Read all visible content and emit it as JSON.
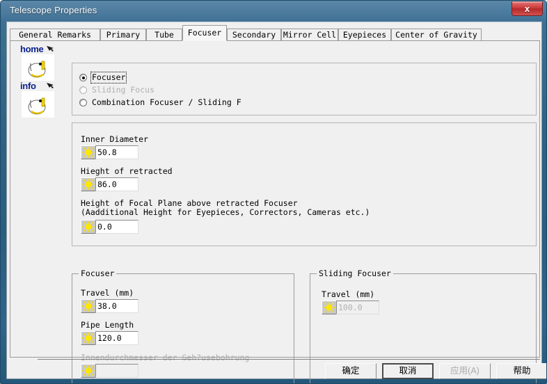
{
  "window": {
    "title": "Telescope Properties",
    "close_label": "x",
    "titlebar_color": "#2e6184",
    "client_bg": "#f0f0f0"
  },
  "tabs": [
    {
      "label": "General Remarks",
      "active": false
    },
    {
      "label": "Primary",
      "active": false
    },
    {
      "label": "Tube",
      "active": false
    },
    {
      "label": "Focuser",
      "active": true
    },
    {
      "label": "Secondary",
      "active": false
    },
    {
      "label": "Mirror Cell",
      "active": false
    },
    {
      "label": "Eyepieces",
      "active": false
    },
    {
      "label": "Center of Gravity",
      "active": false
    }
  ],
  "rail": {
    "items": [
      {
        "label": "home",
        "icon": "bird-icon",
        "arrow": "arrow-right-icon"
      },
      {
        "label": "info",
        "icon": "bird-icon",
        "arrow": "arrow-right-icon"
      }
    ]
  },
  "focuser_type": {
    "options": [
      {
        "label": "Focuser",
        "checked": true,
        "disabled": false,
        "focused": true
      },
      {
        "label": "Sliding Focus",
        "checked": false,
        "disabled": true,
        "focused": false
      },
      {
        "label": "Combination Focuser / Sliding F",
        "checked": false,
        "disabled": false,
        "focused": false
      }
    ]
  },
  "dimensions": {
    "inner_diameter": {
      "label": "Inner Diameter",
      "value": "50.8",
      "icon": "sun-icon",
      "disabled": false
    },
    "height_retracted": {
      "label": "Hieght of retracted",
      "value": "86.0",
      "icon": "sun-icon",
      "disabled": false
    },
    "focal_plane": {
      "label_line1": "Height of Focal Plane above retracted Focuser",
      "label_line2": "(Aadditional Height for Eyepieces, Correctors, Cameras etc.)",
      "value": "0.0",
      "icon": "sun-icon",
      "disabled": false
    }
  },
  "focuser_group": {
    "title": "Focuser",
    "travel": {
      "label": "Travel (mm)",
      "value": "38.0",
      "icon": "sun-icon",
      "disabled": false
    },
    "pipe_length": {
      "label": "Pipe Length",
      "value": "120.0",
      "icon": "sun-icon",
      "disabled": false
    },
    "bore_diameter": {
      "label": "Innendurchmesser der Geh?usebohrung",
      "value": "",
      "icon": "sun-icon",
      "disabled": true
    }
  },
  "sliding_focuser_group": {
    "title": "Sliding Focuser",
    "travel": {
      "label": "Travel (mm)",
      "value": "100.0",
      "icon": "sun-icon",
      "disabled": true
    }
  },
  "buttons": [
    {
      "label": "确定",
      "state": "normal"
    },
    {
      "label": "取消",
      "state": "default"
    },
    {
      "label": "应用(A)",
      "state": "disabled"
    },
    {
      "label": "帮助",
      "state": "normal"
    }
  ]
}
